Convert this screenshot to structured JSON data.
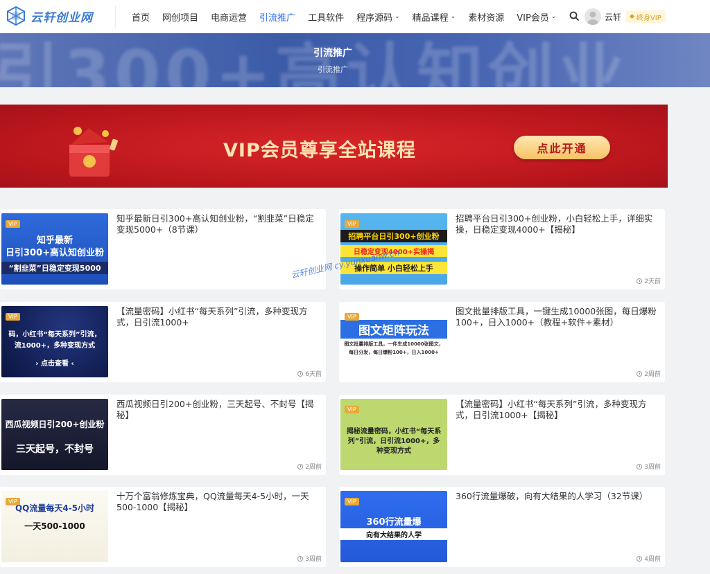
{
  "header": {
    "logo_text": "云轩创业网",
    "nav": [
      {
        "label": "首页",
        "caret": false,
        "active": false
      },
      {
        "label": "网创项目",
        "caret": false,
        "active": false
      },
      {
        "label": "电商运营",
        "caret": false,
        "active": false
      },
      {
        "label": "引流推广",
        "caret": false,
        "active": true
      },
      {
        "label": "工具软件",
        "caret": false,
        "active": false
      },
      {
        "label": "程序源码",
        "caret": true,
        "active": false
      },
      {
        "label": "精品课程",
        "caret": true,
        "active": false
      },
      {
        "label": "素材资源",
        "caret": false,
        "active": false
      },
      {
        "label": "VIP会员",
        "caret": true,
        "active": false
      }
    ],
    "username": "云轩",
    "vip_badge": "终身VIP",
    "accent": "#2468f2"
  },
  "hero": {
    "title": "引流推广",
    "breadcrumb": "引流推广",
    "bg_text": "引300+高认知创业"
  },
  "banner": {
    "text": "VIP会员尊享全站课程",
    "button": "点此开通"
  },
  "watermark": "云轩创业网  cy.yunxuanw.cn",
  "posts": [
    {
      "title": "知乎最新日引300+高认知创业粉，“割韭菜”日稳定变现5000+（8节课）",
      "time": "",
      "badge": "VIP",
      "thumb_lines": [
        "知乎最新",
        "日引300+高认知创业粉",
        "“割韭菜”日稳定变现5000"
      ]
    },
    {
      "title": "招聘平台日引300+创业粉，小白轻松上手，详细实操，日稳定变现4000+【揭秘】",
      "time": "2天前",
      "badge": "VIP",
      "thumb_lines": [
        "招聘平台日引300+创业粉",
        "日稳定变现4000+实操揭",
        "操作简单 小白轻松上手"
      ]
    },
    {
      "title": "【流量密码】小红书“每天系列”引流，多种变现方式，日引流1000+",
      "time": "6天前",
      "badge": "VIP",
      "thumb_lines": [
        "码，小红书“每天系列”引流，",
        "流1000+，多种变现方式",
        "› 点击查看 ‹"
      ]
    },
    {
      "title": "图文批量排版工具，一键生成10000张图，每日爆粉100+，日入1000+（教程+软件+素材）",
      "time": "2周前",
      "badge": "VIP",
      "thumb_lines": [
        "图文矩阵玩法",
        "图文批量排版工具，一件生成10000张图文，",
        "每日分发，每日爆粉100+，日入1000+"
      ]
    },
    {
      "title": "西瓜视频日引200+创业粉，三天起号、不封号【揭秘】",
      "time": "2周前",
      "badge": "",
      "thumb_lines": [
        "西瓜视频日引200+创业粉",
        "三天起号，不封号"
      ]
    },
    {
      "title": "【流量密码】小红书“每天系列”引流，多种变现方式，日引流1000+【揭秘】",
      "time": "3周前",
      "badge": "VIP",
      "thumb_lines": [
        "揭秘流量密码，小红书“每天系",
        "列”引流，日引流1000+，多",
        "种变现方式"
      ]
    },
    {
      "title": "十万个富翁修炼宝典，QQ流量每天4-5小时，一天500-1000【揭秘】",
      "time": "3周前",
      "badge": "VIP",
      "thumb_lines": [
        "QQ流量每天4-5小时",
        "一天500-1000"
      ]
    },
    {
      "title": "360行流量爆破，向有大结果的人学习（32节课）",
      "time": "4周前",
      "badge": "VIP",
      "thumb_lines": [
        "360行流量爆",
        "向有大结果的人学"
      ]
    }
  ]
}
